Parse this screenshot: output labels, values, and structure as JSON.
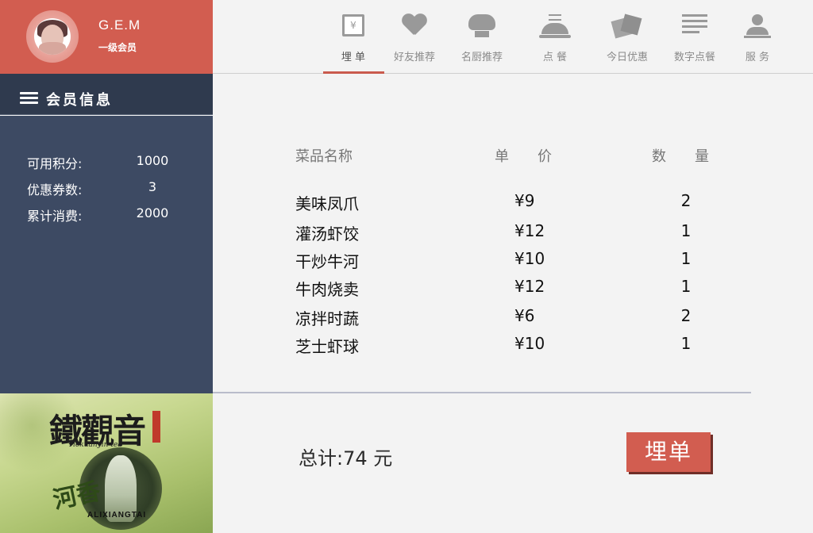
{
  "profile": {
    "name": "G.E.M",
    "level": "一级会员"
  },
  "info": {
    "title": "会员信息",
    "stats": [
      {
        "label": "可用积分:",
        "value": "1000"
      },
      {
        "label": "优惠券数:",
        "value": "3"
      },
      {
        "label": "累计消费:",
        "value": "2000"
      }
    ]
  },
  "ad": {
    "title": "鐵觀音",
    "subtitle": "Tiekuanyin tea",
    "calligraphy": "河香",
    "brand": "ALIXIANGTAI"
  },
  "nav": {
    "items": [
      {
        "label": "埋 单",
        "icon": "bill-icon",
        "glyph": "¥",
        "active": true
      },
      {
        "label": "好友推荐",
        "icon": "heart-icon"
      },
      {
        "label": "名厨推荐",
        "icon": "chef-hat-icon"
      },
      {
        "label": "点 餐",
        "icon": "cloche-icon"
      },
      {
        "label": "今日优惠",
        "icon": "coupon-icon"
      },
      {
        "label": "数字点餐",
        "icon": "list-icon"
      },
      {
        "label": "服 务",
        "icon": "person-icon"
      }
    ]
  },
  "order": {
    "headers": {
      "name": "菜品名称",
      "price": "单　　价",
      "qty": "数　　量"
    },
    "rows": [
      {
        "name": "美味凤爪",
        "price": "¥9",
        "qty": "2"
      },
      {
        "name": "灌汤虾饺",
        "price": "¥12",
        "qty": "1"
      },
      {
        "name": "干炒牛河",
        "price": "¥10",
        "qty": "1"
      },
      {
        "name": "牛肉烧卖",
        "price": "¥12",
        "qty": "1"
      },
      {
        "name": "凉拌时蔬",
        "price": "¥6",
        "qty": "2"
      },
      {
        "name": "芝士虾球",
        "price": "¥10",
        "qty": "1"
      }
    ],
    "total_label": "总计:74 元",
    "pay_label": "埋单"
  },
  "colors": {
    "accent": "#d25d50",
    "sidebar_dark": "#2f3a4e",
    "sidebar": "#3d4a63",
    "background": "#f3f3f3"
  }
}
